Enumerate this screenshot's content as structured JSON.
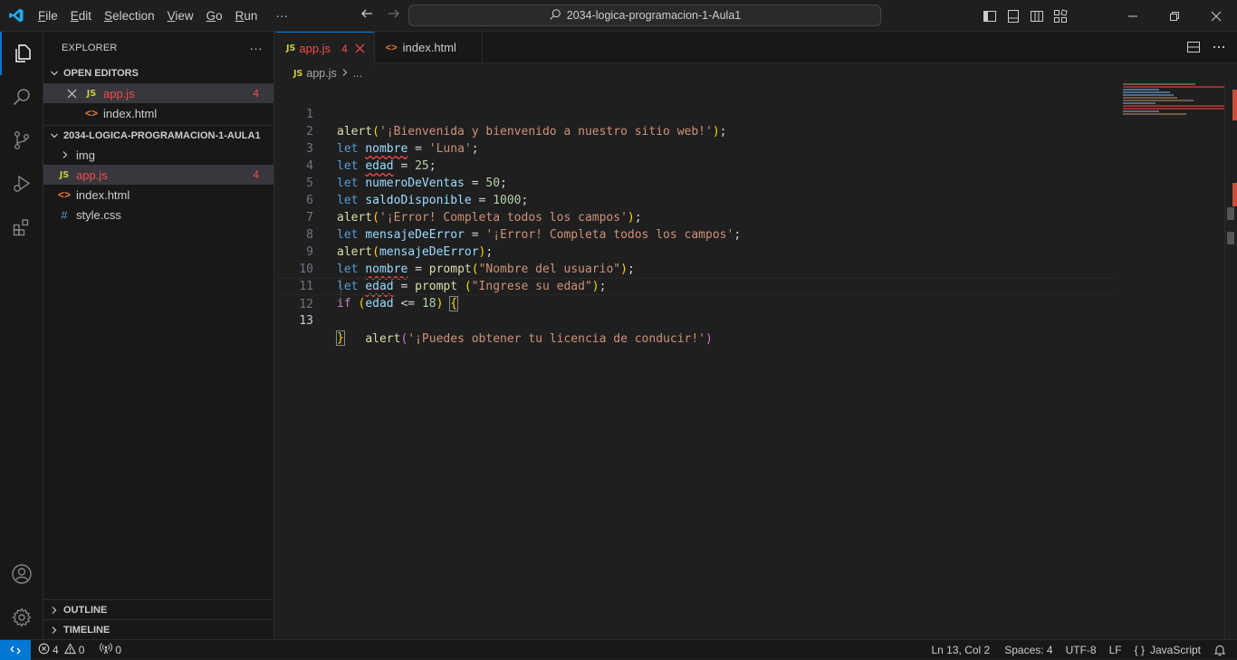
{
  "titlebar": {
    "menu": [
      "File",
      "Edit",
      "Selection",
      "View",
      "Go",
      "Run"
    ],
    "menu_underline": [
      "F",
      "E",
      "S",
      "V",
      "G",
      "R"
    ],
    "menu_rest": [
      "ile",
      "dit",
      "election",
      "iew",
      "o",
      "un"
    ],
    "more": "···",
    "search_text": "2034-logica-programacion-1-Aula1"
  },
  "sidebar": {
    "title": "EXPLORER",
    "more": "···",
    "open_editors_title": "OPEN EDITORS",
    "open_editors": [
      {
        "icon": "JS",
        "name": "app.js",
        "errors": "4"
      },
      {
        "icon": "<>",
        "name": "index.html"
      }
    ],
    "project_title": "2034-LOGICA-PROGRAMACION-1-AULA1",
    "files": [
      {
        "type": "folder",
        "name": "img"
      },
      {
        "icon": "JS",
        "name": "app.js",
        "errors": "4"
      },
      {
        "icon": "<>",
        "name": "index.html"
      },
      {
        "icon": "#",
        "name": "style.css"
      }
    ],
    "outline_title": "OUTLINE",
    "timeline_title": "TIMELINE"
  },
  "editor": {
    "tabs": [
      {
        "icon": "JS",
        "label": "app.js",
        "errors": "4"
      },
      {
        "icon": "<>",
        "label": "index.html"
      }
    ],
    "breadcrumb": {
      "icon": "JS",
      "file": "app.js",
      "rest": "..."
    },
    "line_numbers": [
      "1",
      "2",
      "3",
      "4",
      "5",
      "6",
      "7",
      "8",
      "9",
      "10",
      "11",
      "12",
      "13"
    ]
  },
  "statusbar": {
    "errors": "4",
    "warnings": "0",
    "ports": "0",
    "position": "Ln 13, Col 2",
    "spaces": "Spaces: 4",
    "encoding": "UTF-8",
    "eol": "LF",
    "language": "JavaScript"
  },
  "colors": {
    "accent": "#0078d4",
    "error": "#f14c4c",
    "background": "#1f1f1f"
  }
}
